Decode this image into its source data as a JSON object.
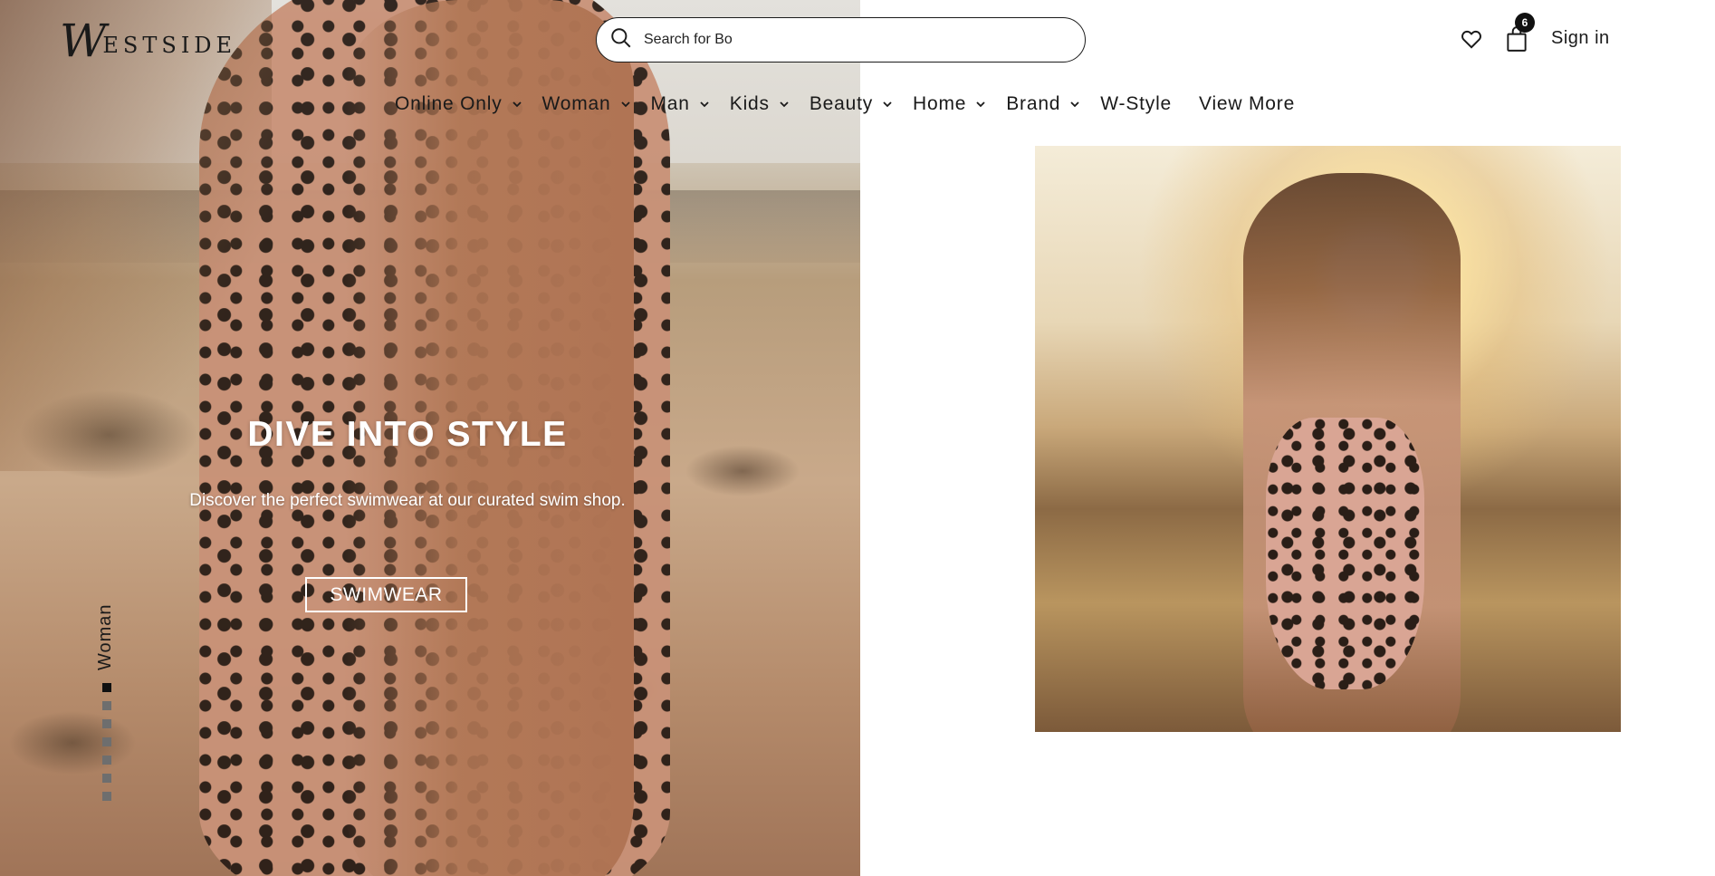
{
  "brand": {
    "logo_initial": "W",
    "logo_rest": "ESTSIDE"
  },
  "search": {
    "placeholder": "Search for Bo",
    "icon": "search-icon"
  },
  "header": {
    "wishlist_icon": "heart-icon",
    "cart_icon": "shopping-bag-icon",
    "cart_count": "6",
    "signin_label": "Sign in"
  },
  "nav": {
    "items": [
      {
        "label": "Online Only",
        "has_dropdown": true
      },
      {
        "label": "Woman",
        "has_dropdown": true
      },
      {
        "label": "Man",
        "has_dropdown": true
      },
      {
        "label": "Kids",
        "has_dropdown": true
      },
      {
        "label": "Beauty",
        "has_dropdown": true
      },
      {
        "label": "Home",
        "has_dropdown": true
      },
      {
        "label": "Brand",
        "has_dropdown": true
      },
      {
        "label": "W-Style",
        "has_dropdown": false
      },
      {
        "label": "View More",
        "has_dropdown": false
      }
    ]
  },
  "hero": {
    "title": "DIVE INTO STYLE",
    "subtitle": "Discover the perfect swimwear at our curated swim shop.",
    "cta_label": "SWIMWEAR",
    "slide_label": "Woman",
    "slide_count": 7,
    "active_slide": 0
  },
  "colors": {
    "text": "#1a1a1a",
    "hero_text": "#ffffff",
    "badge": "#111111"
  }
}
